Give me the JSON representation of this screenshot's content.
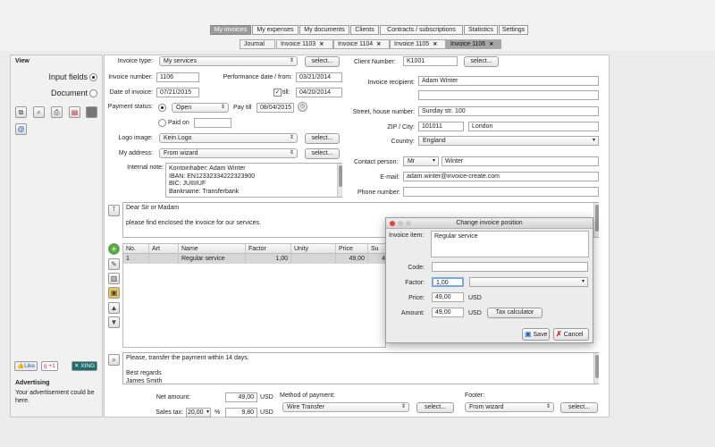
{
  "top_tabs": [
    "My invoices",
    "My expenses",
    "My documents",
    "Clients",
    "Contracts / subscriptions",
    "Statistics",
    "Settings"
  ],
  "doc_tabs": [
    "Journal",
    "Invoice 1103",
    "Invoice 1104",
    "Invoice 1105",
    "Invoice 1106"
  ],
  "sidebar": {
    "view_title": "View",
    "input_fields": "Input fields",
    "document": "Document",
    "like": "Like",
    "gplus": "+1",
    "xing": "XING",
    "adv_title": "Advertising",
    "adv_text": "Your advertisement could be here."
  },
  "form": {
    "invoice_type_label": "Invoice type:",
    "invoice_type_value": "My services",
    "select_btn": "select...",
    "invoice_number_label": "Invoice number:",
    "invoice_number_value": "1106",
    "perf_date_label": "Performance date / from:",
    "perf_date_value": "03/21/2014",
    "date_label": "Date of invoice:",
    "date_value": "07/21/2015",
    "till_label": "till:",
    "till_value": "04/20/2014",
    "payment_status_label": "Payment status:",
    "payment_status_value": "Open",
    "pay_till_label": "Pay till",
    "pay_till_value": "08/04/2015",
    "paid_on_label": "Paid on",
    "logo_label": "Logo image:",
    "logo_value": "Kein Logo",
    "address_label": "My address:",
    "address_value": "From wizard",
    "internal_note_label": "Internal note:",
    "internal_note_lines": [
      "Kontoinhaber: Adam Winter",
      "IBAN: EN12332334222323900",
      "BIC: JUIIIIUF",
      "Bankname: Transferbank"
    ]
  },
  "client": {
    "number_label": "Client Number:",
    "number_value": "K1001",
    "recipient_label": "Invoice recipient:",
    "recipient_value": "Adam Winter",
    "street_label": "Street, house number:",
    "street_value": "Sunday str. 100",
    "zip_label": "ZIP / City:",
    "zip_value": "101011",
    "city_value": "London",
    "country_label": "Country:",
    "country_value": "England",
    "contact_label": "Contact person:",
    "contact_title": "Mr",
    "contact_name": "Winter",
    "email_label": "E-mail:",
    "email_value": "adam.winter@invoice-create.com",
    "phone_label": "Phone number:"
  },
  "intro_text": [
    "Dear Sir or Madam",
    "",
    "please find enclosed the invoice for our services."
  ],
  "positions": {
    "headers": [
      "No.",
      "Art",
      "Name",
      "Factor",
      "Unity",
      "Price",
      "Su"
    ],
    "rows": [
      [
        "1",
        "",
        "Regular service",
        "1,00",
        "",
        "49,00",
        "4"
      ]
    ]
  },
  "closing_text": [
    "Please, transfer the payment within 14 days.",
    "",
    "Best regards",
    "James Smith"
  ],
  "totals": {
    "net_label": "Net amount:",
    "net_value": "49,00",
    "currency": "USD",
    "tax_label": "Sales tax:",
    "tax_rate": "20,00",
    "percent": "%",
    "tax_value": "9,80",
    "payment_method_label": "Method of payment:",
    "payment_method_value": "Wire Transfer",
    "footer_label": "Footer:",
    "footer_value": "From wizard"
  },
  "dialog": {
    "title": "Change invoice position",
    "item_label": "Invoice item:",
    "item_value": "Regular service",
    "code_label": "Code:",
    "factor_label": "Factor:",
    "factor_value": "1,00",
    "price_label": "Price:",
    "price_value": "49,00",
    "amount_label": "Amount:",
    "amount_value": "49,00",
    "currency": "USD",
    "tax_calc": "Tax calculator",
    "save": "Save",
    "cancel": "Cancel"
  }
}
